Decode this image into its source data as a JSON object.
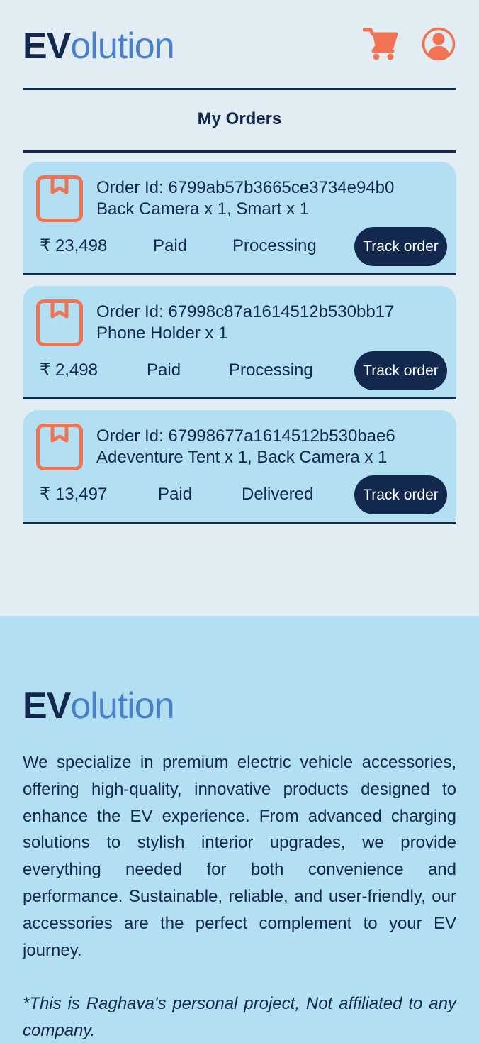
{
  "header": {
    "logo_bold": "EV",
    "logo_rest": "olution",
    "cart_icon": "shopping-cart-icon",
    "user_icon": "user-account-icon",
    "accent": "#f07353"
  },
  "page": {
    "title": "My Orders"
  },
  "orders": [
    {
      "id_label": "Order Id: 6799ab57b3665ce3734e94b0",
      "items": "Back Camera x 1, Smart x 1",
      "price": "₹ 23,498",
      "payment": "Paid",
      "status": "Processing",
      "track_label": "Track order"
    },
    {
      "id_label": "Order Id: 67998c87a1614512b530bb17",
      "items": "Phone Holder x 1",
      "price": "₹ 2,498",
      "payment": "Paid",
      "status": "Processing",
      "track_label": "Track order"
    },
    {
      "id_label": "Order Id: 67998677a1614512b530bae6",
      "items": "Adeventure Tent x 1, Back Camera x 1",
      "price": "₹ 13,497",
      "payment": "Paid",
      "status": "Delivered",
      "track_label": "Track order"
    }
  ],
  "footer": {
    "logo_bold": "EV",
    "logo_rest": "olution",
    "description": "We specialize in premium electric vehicle accessories, offering high-quality, innovative products designed to enhance the EV experience. From advanced charging solutions to stylish interior upgrades, we provide everything needed for both convenience and performance. Sustainable, reliable, and user-friendly, our accessories are the perfect complement to your EV journey.",
    "disclaimer": "*This is Raghava's personal project, Not affiliated to any company."
  },
  "colors": {
    "navy": "#13284f",
    "logo_blue": "#4a80c8",
    "card_bg": "#b3dff2",
    "page_bg": "#e1edf3",
    "accent": "#f07353"
  }
}
